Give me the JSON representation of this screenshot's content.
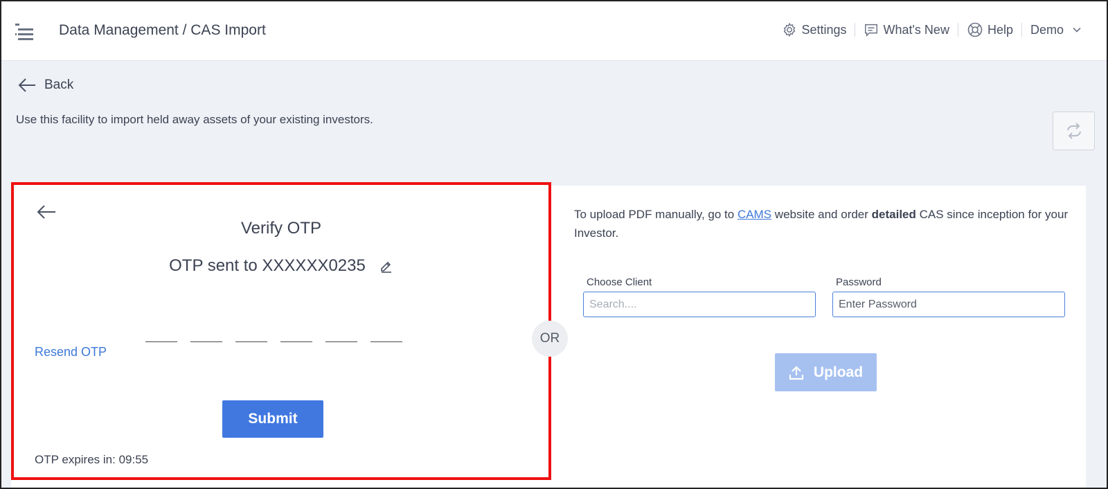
{
  "header": {
    "title": "Data Management / CAS Import",
    "nav": {
      "settings": "Settings",
      "whats_new": "What's New",
      "help": "Help",
      "user": "Demo"
    }
  },
  "back_label": "Back",
  "intro": "Use this facility to import held away assets of your existing investors.",
  "otp_panel": {
    "title": "Verify OTP",
    "sent_to": "OTP sent to XXXXXX0235",
    "resend": "Resend OTP",
    "submit": "Submit",
    "expires": "OTP expires in: 09:55"
  },
  "or_label": "OR",
  "upload_panel": {
    "text_before": "To upload PDF manually, go to ",
    "link": "CAMS",
    "text_middle": " website and order ",
    "bold": "detailed",
    "text_after": " CAS since inception for your Investor.",
    "client_label": "Choose Client",
    "client_placeholder": "Search....",
    "password_label": "Password",
    "password_placeholder": "Enter Password",
    "upload": "Upload"
  },
  "colors": {
    "accent": "#4178e0",
    "link": "#3c78d8",
    "highlight_border": "#ee1111",
    "upload_disabled": "#a6c1f0"
  },
  "icons": [
    "menu-icon",
    "gear-icon",
    "message-icon",
    "lifebuoy-icon",
    "chevron-down-icon",
    "arrow-left-icon",
    "refresh-icon",
    "pencil-icon",
    "upload-icon"
  ]
}
